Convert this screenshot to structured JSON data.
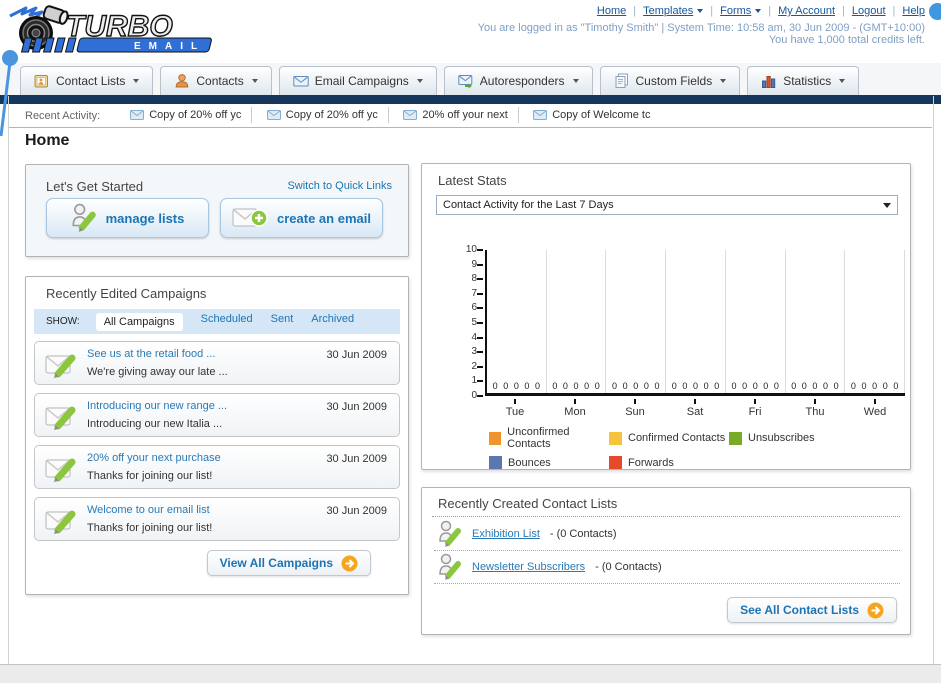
{
  "colors": {
    "accent_blue": "#1d74b4",
    "navy_bar": "#16365c",
    "button_orange": "#f6a51e",
    "link_blue": "#15569c"
  },
  "header": {
    "logo": {
      "title": "TURBO",
      "subtitle": "EMAIL"
    },
    "nav": [
      {
        "label": "Home"
      },
      {
        "label": "Templates",
        "dropdown": true
      },
      {
        "label": "Forms",
        "dropdown": true
      },
      {
        "label": "My Account"
      },
      {
        "label": "Logout"
      },
      {
        "label": "Help"
      }
    ],
    "login_info": "You are logged in as \"Timothy Smith\" | System Time: 10:58 am, 30 Jun 2009 - (GMT+10:00)",
    "credits_info": "You have 1,000 total credits left."
  },
  "tabs": [
    {
      "label": "Contact Lists"
    },
    {
      "label": "Contacts"
    },
    {
      "label": "Email Campaigns"
    },
    {
      "label": "Autoresponders"
    },
    {
      "label": "Custom Fields"
    },
    {
      "label": "Statistics"
    }
  ],
  "recent_activity": {
    "label": "Recent Activity:",
    "items": [
      "Copy of 20% off yc",
      "Copy of 20% off yc",
      "20% off your next",
      "Copy of Welcome tc"
    ]
  },
  "page_title": "Home",
  "get_started": {
    "title": "Let's Get Started",
    "switch_link": "Switch to Quick Links",
    "buttons": [
      {
        "label": "manage lists"
      },
      {
        "label": "create an email"
      }
    ]
  },
  "campaigns_panel": {
    "title": "Recently Edited Campaigns",
    "show_label": "SHOW:",
    "filters": [
      "All Campaigns",
      "Scheduled",
      "Sent",
      "Archived"
    ],
    "active_filter": "All Campaigns",
    "items": [
      {
        "title": "See us at the retail food ...",
        "subtitle": "We're giving away our late ...",
        "date": "30 Jun 2009"
      },
      {
        "title": "Introducing our new range ...",
        "subtitle": "Introducing our new Italia ...",
        "date": "30 Jun 2009"
      },
      {
        "title": "20% off your next purchase",
        "subtitle": "Thanks for joining our list!",
        "date": "30 Jun 2009"
      },
      {
        "title": "Welcome to our email list",
        "subtitle": "Thanks for joining our list!",
        "date": "30 Jun 2009"
      }
    ],
    "view_all_label": "View All Campaigns"
  },
  "stats_panel": {
    "title": "Latest Stats",
    "dropdown_value": "Contact Activity for the Last 7 Days"
  },
  "chart_data": {
    "type": "bar",
    "title": "Contact Activity for the Last 7 Days",
    "categories": [
      "Tue",
      "Mon",
      "Sun",
      "Sat",
      "Fri",
      "Thu",
      "Wed"
    ],
    "series": [
      {
        "name": "Unconfirmed Contacts",
        "color": "#f2942d",
        "values": [
          0,
          0,
          0,
          0,
          0,
          0,
          0
        ]
      },
      {
        "name": "Confirmed Contacts",
        "color": "#f6c33a",
        "values": [
          0,
          0,
          0,
          0,
          0,
          0,
          0
        ]
      },
      {
        "name": "Unsubscribes",
        "color": "#7aab27",
        "values": [
          0,
          0,
          0,
          0,
          0,
          0,
          0
        ]
      },
      {
        "name": "Bounces",
        "color": "#5a77b0",
        "values": [
          0,
          0,
          0,
          0,
          0,
          0,
          0
        ]
      },
      {
        "name": "Forwards",
        "color": "#e64a2a",
        "values": [
          0,
          0,
          0,
          0,
          0,
          0,
          0
        ]
      }
    ],
    "ylim": [
      0,
      10
    ],
    "yticks": [
      0,
      1,
      2,
      3,
      4,
      5,
      6,
      7,
      8,
      9,
      10
    ],
    "grid": true,
    "legend_position": "bottom",
    "value_labels_shown": true
  },
  "contact_lists_panel": {
    "title": "Recently Created Contact Lists",
    "items": [
      {
        "name": "Exhibition List",
        "detail": "- (0 Contacts)"
      },
      {
        "name": "Newsletter Subscribers",
        "detail": "- (0 Contacts)"
      }
    ],
    "see_all_label": "See All Contact Lists"
  }
}
